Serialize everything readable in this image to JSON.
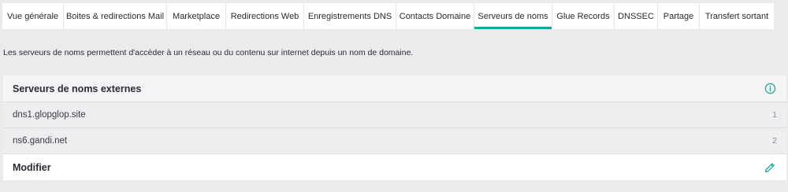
{
  "tabs": [
    {
      "label": "Vue générale",
      "active": false
    },
    {
      "label": "Boites & redirections Mail",
      "active": false
    },
    {
      "label": "Marketplace",
      "active": false
    },
    {
      "label": "Redirections Web",
      "active": false
    },
    {
      "label": "Enregistrements DNS",
      "active": false
    },
    {
      "label": "Contacts Domaine",
      "active": false
    },
    {
      "label": "Serveurs de noms",
      "active": true
    },
    {
      "label": "Glue Records",
      "active": false
    },
    {
      "label": "DNSSEC",
      "active": false
    },
    {
      "label": "Partage",
      "active": false
    },
    {
      "label": "Transfert sortant",
      "active": false
    }
  ],
  "description": "Les serveurs de noms permettent d'accéder à un réseau ou du contenu sur internet depuis un nom de domaine.",
  "panel": {
    "title": "Serveurs de noms externes",
    "info_icon": "info-icon",
    "nameservers": [
      {
        "name": "dns1.glopglop.site",
        "index": "1"
      },
      {
        "name": "ns6.gandi.net",
        "index": "2"
      }
    ],
    "modify_label": "Modifier",
    "modify_icon": "pencil-icon"
  },
  "colors": {
    "accent": "#1fa49a",
    "background": "#e9ebed"
  }
}
